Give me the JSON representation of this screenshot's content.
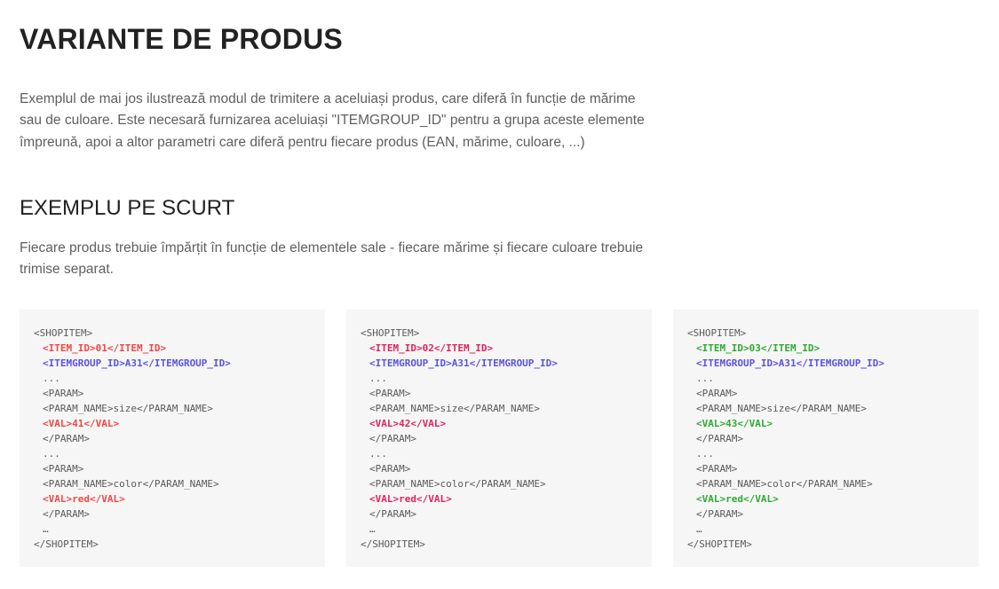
{
  "page": {
    "title": "VARIANTE DE PRODUS",
    "intro": "Exemplul de mai jos ilustrează modul de trimitere a aceluiași produs, care diferă în funcție de mărime sau de culoare. Este necesară furnizarea aceluiași \"ITEMGROUP_ID\" pentru a grupa aceste elemente împreună, apoi a altor parametri care diferă pentru fiecare produs (EAN, mărime, culoare, ...)",
    "subtitle": "EXEMPLU PE SCURT",
    "description": "Fiecare produs trebuie împărțit în funcție de elementele sale - fiecare mărime și fiecare culoare trebuie trimise separat."
  },
  "colors": {
    "code_bg": "#f6f6f6",
    "example1_item": "#ef4848",
    "example1_val": "#e0245e",
    "example2_item": "#e0245e",
    "example2_val": "#e0245e",
    "example3_item": "#2faa35",
    "example3_val": "#2faa35",
    "group_id": "#5a54e0"
  },
  "examples": [
    {
      "lines": [
        "<SHOPITEM>",
        "<ITEM_ID>01</ITEM_ID>",
        "<ITEMGROUP_ID>A31</ITEMGROUP_ID>",
        "...",
        "<PARAM>",
        "<PARAM_NAME>size</PARAM_NAME>",
        "<VAL>41</VAL>",
        "</PARAM>",
        "...",
        "<PARAM>",
        "<PARAM_NAME>color</PARAM_NAME>",
        "<VAL>red</VAL>",
        "</PARAM>",
        "…",
        "</SHOPITEM>"
      ]
    },
    {
      "lines": [
        "<SHOPITEM>",
        "<ITEM_ID>02</ITEM_ID>",
        "<ITEMGROUP_ID>A31</ITEMGROUP_ID>",
        "...",
        "<PARAM>",
        "<PARAM_NAME>size</PARAM_NAME>",
        "<VAL>42</VAL>",
        "</PARAM>",
        "...",
        "<PARAM>",
        "<PARAM_NAME>color</PARAM_NAME>",
        "<VAL>red</VAL>",
        "</PARAM>",
        "…",
        "</SHOPITEM>"
      ]
    },
    {
      "lines": [
        "<SHOPITEM>",
        "<ITEM_ID>03</ITEM_ID>",
        "<ITEMGROUP_ID>A31</ITEMGROUP_ID>",
        "...",
        "<PARAM>",
        "<PARAM_NAME>size</PARAM_NAME>",
        "<VAL>43</VAL>",
        "</PARAM>",
        "...",
        "<PARAM>",
        "<PARAM_NAME>color</PARAM_NAME>",
        "<VAL>red</VAL>",
        "</PARAM>",
        "…",
        "</SHOPITEM>"
      ]
    }
  ]
}
